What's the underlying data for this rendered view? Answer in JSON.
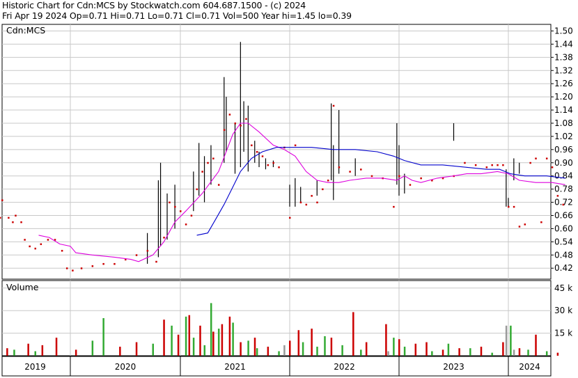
{
  "header": {
    "line1": "Historic Chart for Cdn:MCS by Stockwatch.com 604.687.1500 - (c) 2024",
    "line2": "Fri Apr 19 2024   Op=0.71  Hi=0.71  Lo=0.71  Cl=0.71  Vol=500   Year hi=1.45  lo=0.39"
  },
  "chart_data": [
    {
      "type": "line",
      "title": "Cdn:MCS",
      "x_years": [
        "2019",
        "2020",
        "2021",
        "2022",
        "2023",
        "2024"
      ],
      "ylim": [
        0.37,
        1.53
      ],
      "y_ticks": [
        "1.50",
        "1.44",
        "1.38",
        "1.32",
        "1.26",
        "1.20",
        "1.14",
        "1.08",
        "1.02",
        "0.96",
        "0.90",
        "0.84",
        "0.78",
        "0.72",
        "0.66",
        "0.60",
        "0.54",
        "0.48",
        "0.42"
      ],
      "grid": true,
      "series": [
        {
          "kind": "close",
          "color": "#cc0000",
          "values": [
            [
              2019.0,
              0.65
            ],
            [
              2019.03,
              0.73
            ],
            [
              2019.12,
              0.65
            ],
            [
              2019.18,
              0.63
            ],
            [
              2019.22,
              0.66
            ],
            [
              2019.3,
              0.63
            ],
            [
              2019.35,
              0.55
            ],
            [
              2019.42,
              0.52
            ],
            [
              2019.5,
              0.51
            ],
            [
              2019.58,
              0.53
            ],
            [
              2019.68,
              0.55
            ],
            [
              2019.78,
              0.55
            ],
            [
              2019.88,
              0.5
            ],
            [
              2019.95,
              0.42
            ],
            [
              2020.02,
              0.41
            ],
            [
              2020.1,
              0.42
            ],
            [
              2020.2,
              0.43
            ],
            [
              2020.3,
              0.44
            ],
            [
              2020.4,
              0.44
            ],
            [
              2020.5,
              0.46
            ],
            [
              2020.6,
              0.48
            ],
            [
              2020.7,
              0.5
            ],
            [
              2020.78,
              0.45
            ],
            [
              2020.85,
              0.56
            ],
            [
              2020.9,
              0.72
            ],
            [
              2020.95,
              0.7
            ],
            [
              2021.0,
              0.68
            ],
            [
              2021.05,
              0.62
            ],
            [
              2021.1,
              0.66
            ],
            [
              2021.15,
              0.78
            ],
            [
              2021.2,
              0.86
            ],
            [
              2021.25,
              0.9
            ],
            [
              2021.3,
              0.92
            ],
            [
              2021.35,
              0.8
            ],
            [
              2021.4,
              1.05
            ],
            [
              2021.45,
              1.12
            ],
            [
              2021.5,
              1.08
            ],
            [
              2021.55,
              1.07
            ],
            [
              2021.6,
              1.1
            ],
            [
              2021.65,
              0.98
            ],
            [
              2021.7,
              0.95
            ],
            [
              2021.75,
              0.93
            ],
            [
              2021.8,
              0.89
            ],
            [
              2021.85,
              0.9
            ],
            [
              2021.9,
              0.88
            ],
            [
              2021.95,
              0.97
            ],
            [
              2022.0,
              0.65
            ],
            [
              2022.05,
              0.98
            ],
            [
              2022.1,
              0.72
            ],
            [
              2022.15,
              0.71
            ],
            [
              2022.2,
              0.75
            ],
            [
              2022.25,
              0.72
            ],
            [
              2022.3,
              0.78
            ],
            [
              2022.35,
              0.82
            ],
            [
              2022.4,
              1.16
            ],
            [
              2022.45,
              0.88
            ],
            [
              2022.55,
              0.86
            ],
            [
              2022.65,
              0.87
            ],
            [
              2022.75,
              0.84
            ],
            [
              2022.85,
              0.83
            ],
            [
              2022.95,
              0.7
            ],
            [
              2023.0,
              0.84
            ],
            [
              2023.1,
              0.8
            ],
            [
              2023.2,
              0.83
            ],
            [
              2023.3,
              0.82
            ],
            [
              2023.4,
              0.83
            ],
            [
              2023.5,
              0.84
            ],
            [
              2023.6,
              0.9
            ],
            [
              2023.7,
              0.89
            ],
            [
              2023.8,
              0.88
            ],
            [
              2023.85,
              0.89
            ],
            [
              2023.9,
              0.89
            ],
            [
              2023.95,
              0.89
            ],
            [
              2024.0,
              0.7
            ],
            [
              2024.05,
              0.7
            ],
            [
              2024.1,
              0.61
            ],
            [
              2024.15,
              0.62
            ],
            [
              2024.2,
              0.9
            ],
            [
              2024.25,
              0.92
            ],
            [
              2024.3,
              0.63
            ],
            [
              2024.35,
              0.92
            ],
            [
              2024.4,
              0.88
            ],
            [
              2024.45,
              0.75
            ],
            [
              2024.5,
              0.71
            ]
          ]
        },
        {
          "kind": "ma-short",
          "color": "#dd00dd",
          "values": [
            [
              2019.55,
              0.57
            ],
            [
              2019.7,
              0.56
            ],
            [
              2019.85,
              0.53
            ],
            [
              2020.0,
              0.52
            ],
            [
              2020.05,
              0.49
            ],
            [
              2020.2,
              0.48
            ],
            [
              2020.4,
              0.47
            ],
            [
              2020.55,
              0.46
            ],
            [
              2020.62,
              0.45
            ],
            [
              2020.75,
              0.48
            ],
            [
              2020.85,
              0.54
            ],
            [
              2020.95,
              0.63
            ],
            [
              2021.05,
              0.68
            ],
            [
              2021.2,
              0.76
            ],
            [
              2021.35,
              0.86
            ],
            [
              2021.48,
              1.03
            ],
            [
              2021.55,
              1.08
            ],
            [
              2021.62,
              1.08
            ],
            [
              2021.72,
              1.04
            ],
            [
              2021.85,
              0.98
            ],
            [
              2021.95,
              0.96
            ],
            [
              2022.05,
              0.93
            ],
            [
              2022.15,
              0.86
            ],
            [
              2022.25,
              0.82
            ],
            [
              2022.35,
              0.81
            ],
            [
              2022.45,
              0.81
            ],
            [
              2022.55,
              0.82
            ],
            [
              2022.7,
              0.83
            ],
            [
              2022.85,
              0.83
            ],
            [
              2022.98,
              0.82
            ],
            [
              2023.05,
              0.84
            ],
            [
              2023.12,
              0.82
            ],
            [
              2023.2,
              0.81
            ],
            [
              2023.35,
              0.83
            ],
            [
              2023.5,
              0.84
            ],
            [
              2023.62,
              0.85
            ],
            [
              2023.75,
              0.85
            ],
            [
              2023.9,
              0.86
            ],
            [
              2024.0,
              0.85
            ],
            [
              2024.1,
              0.82
            ],
            [
              2024.25,
              0.81
            ],
            [
              2024.4,
              0.81
            ],
            [
              2024.52,
              0.8
            ]
          ]
        },
        {
          "kind": "ma-long",
          "color": "#0000cc",
          "values": [
            [
              2021.15,
              0.57
            ],
            [
              2021.25,
              0.58
            ],
            [
              2021.32,
              0.64
            ],
            [
              2021.4,
              0.71
            ],
            [
              2021.48,
              0.79
            ],
            [
              2021.55,
              0.86
            ],
            [
              2021.65,
              0.92
            ],
            [
              2021.75,
              0.95
            ],
            [
              2021.88,
              0.97
            ],
            [
              2022.0,
              0.97
            ],
            [
              2022.2,
              0.97
            ],
            [
              2022.4,
              0.96
            ],
            [
              2022.6,
              0.96
            ],
            [
              2022.8,
              0.95
            ],
            [
              2022.95,
              0.93
            ],
            [
              2023.05,
              0.91
            ],
            [
              2023.2,
              0.89
            ],
            [
              2023.4,
              0.89
            ],
            [
              2023.6,
              0.88
            ],
            [
              2023.8,
              0.87
            ],
            [
              2023.92,
              0.87
            ],
            [
              2024.02,
              0.85
            ],
            [
              2024.15,
              0.84
            ],
            [
              2024.35,
              0.84
            ],
            [
              2024.52,
              0.83
            ]
          ]
        }
      ],
      "high_low_bars": [
        [
          2020.7,
          0.44,
          0.58
        ],
        [
          2020.8,
          0.47,
          0.82
        ],
        [
          2020.82,
          0.52,
          0.9
        ],
        [
          2020.88,
          0.55,
          0.76
        ],
        [
          2020.95,
          0.6,
          0.8
        ],
        [
          2021.12,
          0.68,
          0.86
        ],
        [
          2021.17,
          0.75,
          0.99
        ],
        [
          2021.22,
          0.72,
          0.93
        ],
        [
          2021.28,
          0.8,
          0.98
        ],
        [
          2021.4,
          0.9,
          1.29
        ],
        [
          2021.42,
          0.95,
          1.2
        ],
        [
          2021.5,
          0.85,
          1.08
        ],
        [
          2021.55,
          0.88,
          1.45
        ],
        [
          2021.58,
          0.95,
          1.18
        ],
        [
          2021.62,
          0.86,
          1.16
        ],
        [
          2021.68,
          0.9,
          1.0
        ],
        [
          2021.72,
          0.88,
          0.95
        ],
        [
          2021.78,
          0.87,
          0.92
        ],
        [
          2021.85,
          0.88,
          0.91
        ],
        [
          2022.0,
          0.7,
          0.8
        ],
        [
          2022.05,
          0.7,
          0.83
        ],
        [
          2022.1,
          0.72,
          0.79
        ],
        [
          2022.25,
          0.75,
          0.82
        ],
        [
          2022.38,
          0.82,
          1.17
        ],
        [
          2022.4,
          0.73,
          0.98
        ],
        [
          2022.45,
          0.85,
          1.14
        ],
        [
          2022.6,
          0.84,
          0.92
        ],
        [
          2022.98,
          0.8,
          1.08
        ],
        [
          2023.0,
          0.75,
          0.98
        ],
        [
          2023.05,
          0.76,
          0.85
        ],
        [
          2023.5,
          1.0,
          1.08
        ],
        [
          2023.98,
          0.7,
          0.87
        ],
        [
          2024.0,
          0.7,
          0.74
        ],
        [
          2024.05,
          0.82,
          0.92
        ],
        [
          2024.1,
          0.85,
          0.9
        ]
      ]
    },
    {
      "type": "bar",
      "title": "Volume",
      "y_ticks": [
        "45 k",
        "30 k",
        "15 k"
      ],
      "ylim": [
        0,
        50000
      ],
      "up_color": "#33aa33",
      "down_color": "#cc0000",
      "neutral_color": "#999999",
      "series": [
        {
          "name": "up",
          "values": [
            [
              2019.2,
              4000
            ],
            [
              2019.5,
              3000
            ],
            [
              2020.2,
              10000
            ],
            [
              2020.3,
              25000
            ],
            [
              2020.75,
              8000
            ],
            [
              2020.92,
              20000
            ],
            [
              2021.05,
              26000
            ],
            [
              2021.12,
              12000
            ],
            [
              2021.22,
              7000
            ],
            [
              2021.28,
              35000
            ],
            [
              2021.35,
              18000
            ],
            [
              2021.48,
              22000
            ],
            [
              2021.62,
              10000
            ],
            [
              2021.7,
              5000
            ],
            [
              2021.9,
              3000
            ],
            [
              2022.12,
              9000
            ],
            [
              2022.25,
              6000
            ],
            [
              2022.32,
              13000
            ],
            [
              2022.48,
              7000
            ],
            [
              2022.65,
              4000
            ],
            [
              2022.95,
              12000
            ],
            [
              2023.05,
              6000
            ],
            [
              2023.3,
              3000
            ],
            [
              2023.45,
              8000
            ],
            [
              2023.65,
              5000
            ],
            [
              2023.85,
              2000
            ],
            [
              2024.02,
              20000
            ],
            [
              2024.18,
              4000
            ],
            [
              2024.35,
              3000
            ]
          ]
        },
        {
          "name": "down",
          "values": [
            [
              2019.1,
              5000
            ],
            [
              2019.4,
              8000
            ],
            [
              2019.6,
              7000
            ],
            [
              2019.8,
              12000
            ],
            [
              2020.05,
              4000
            ],
            [
              2020.45,
              6000
            ],
            [
              2020.6,
              9000
            ],
            [
              2020.85,
              24000
            ],
            [
              2020.98,
              14000
            ],
            [
              2021.08,
              27000
            ],
            [
              2021.18,
              20000
            ],
            [
              2021.3,
              16000
            ],
            [
              2021.38,
              21000
            ],
            [
              2021.45,
              26000
            ],
            [
              2021.55,
              9000
            ],
            [
              2021.68,
              12000
            ],
            [
              2021.8,
              6000
            ],
            [
              2022.0,
              10000
            ],
            [
              2022.08,
              17000
            ],
            [
              2022.2,
              18000
            ],
            [
              2022.38,
              12000
            ],
            [
              2022.58,
              29000
            ],
            [
              2022.7,
              9000
            ],
            [
              2022.88,
              21000
            ],
            [
              2023.0,
              11000
            ],
            [
              2023.15,
              8000
            ],
            [
              2023.25,
              9000
            ],
            [
              2023.4,
              4000
            ],
            [
              2023.55,
              5000
            ],
            [
              2023.75,
              6000
            ],
            [
              2023.95,
              9000
            ],
            [
              2024.1,
              5000
            ],
            [
              2024.25,
              14000
            ],
            [
              2024.45,
              2000
            ]
          ]
        },
        {
          "name": "neutral",
          "values": [
            [
              2021.95,
              7000
            ],
            [
              2022.9,
              3000
            ],
            [
              2023.98,
              20000
            ],
            [
              2024.05,
              4000
            ]
          ]
        }
      ]
    }
  ]
}
